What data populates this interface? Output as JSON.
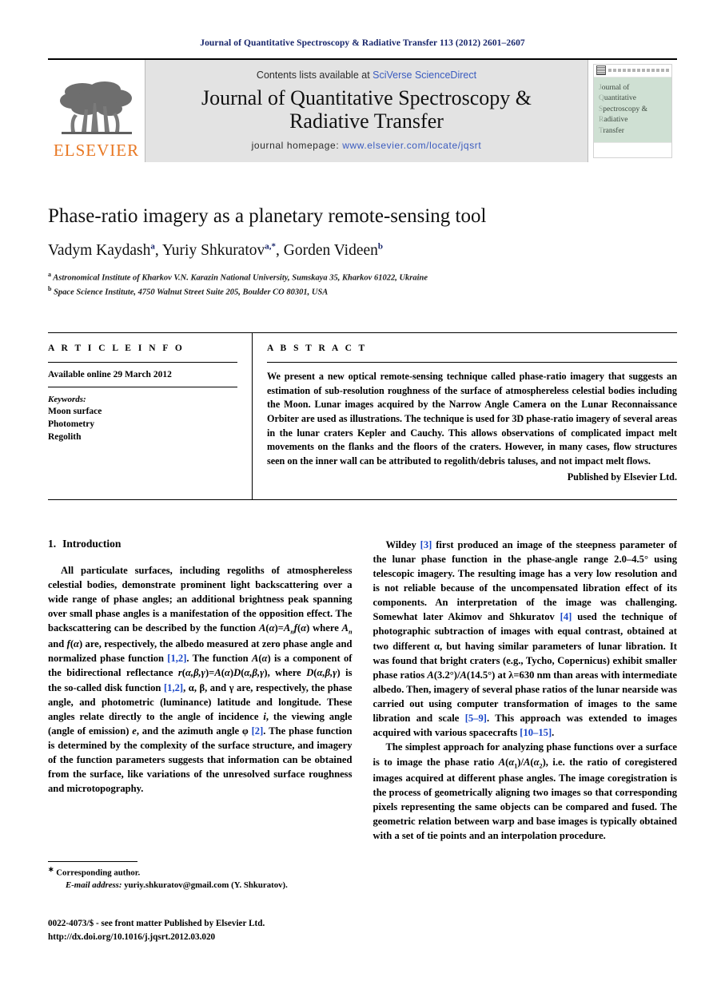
{
  "running_head": "Journal of Quantitative Spectroscopy & Radiative Transfer 113 (2012) 2601–2607",
  "masthead": {
    "publisher_name": "ELSEVIER",
    "contents_prefix": "Contents lists available at ",
    "contents_link": "SciVerse ScienceDirect",
    "journal_title_line1": "Journal of Quantitative Spectroscopy &",
    "journal_title_line2": "Radiative Transfer",
    "homepage_prefix": "journal homepage: ",
    "homepage_url": "www.elsevier.com/locate/jqsrt",
    "cover_lines": [
      "ournal of",
      "uantitative",
      "pectroscopy &",
      "adiative",
      "ransfer"
    ],
    "cover_caps": [
      "J",
      "Q",
      "S",
      "R",
      "T"
    ]
  },
  "article": {
    "title": "Phase-ratio imagery as a planetary remote-sensing tool",
    "authors": [
      {
        "name": "Vadym Kaydash",
        "marks": "a",
        "sep": ", "
      },
      {
        "name": "Yuriy Shkuratov",
        "marks": "a,*",
        "sep": ", "
      },
      {
        "name": "Gorden Videen",
        "marks": "b",
        "sep": ""
      }
    ],
    "affiliations": [
      {
        "mark": "a",
        "text": "Astronomical Institute of Kharkov V.N. Karazin National University, Sumskaya 35, Kharkov 61022, Ukraine"
      },
      {
        "mark": "b",
        "text": "Space Science Institute, 4750 Walnut Street Suite 205, Boulder CO 80301, USA"
      }
    ]
  },
  "info": {
    "heading": "A R T I C L E   I N F O",
    "history": "Available online 29 March 2012",
    "keywords_label": "Keywords:",
    "keywords": [
      "Moon surface",
      "Photometry",
      "Regolith"
    ]
  },
  "abstract": {
    "heading": "A B S T R A C T",
    "text": "We present a new optical remote-sensing technique called phase-ratio imagery that suggests an estimation of sub-resolution roughness of the surface of atmosphereless celestial bodies including the Moon. Lunar images acquired by the Narrow Angle Camera on the Lunar Reconnaissance Orbiter are used as illustrations. The technique is used for 3D phase-ratio imagery of several areas in the lunar craters Kepler and Cauchy. This allows observations of complicated impact melt movements on the flanks and the floors of the craters. However, in many cases, flow structures seen on the inner wall can be attributed to regolith/debris taluses, and not impact melt flows.",
    "publisher_note": "Published by Elsevier Ltd."
  },
  "body": {
    "section_number": "1.",
    "section_title": "Introduction",
    "left_paragraph_1_a": "All particulate surfaces, including regoliths of atmosphereless celestial bodies, demonstrate prominent light backscattering over a wide range of phase angles; an additional brightness peak spanning over small phase angles is a manifestation of the opposition effect. The backscattering can be described by the function ",
    "left_paragraph_1_b": " where ",
    "left_paragraph_1_c": " and ",
    "left_paragraph_1_d": " are, respectively, the albedo measured at zero phase angle and normalized phase function ",
    "ref_12": "[1,2]",
    "left_paragraph_1_e": ". The function ",
    "left_paragraph_1_f": " is a component of the bidirectional reflectance ",
    "left_paragraph_1_g": ", where ",
    "left_paragraph_1_h": " is the so-called disk function ",
    "left_paragraph_1_i": ", α, β, and γ are, respectively, the phase angle, and photometric (luminance) latitude and longitude. These angles relate directly to the angle of incidence ",
    "left_paragraph_1_j": ", the viewing angle (angle of emission) ",
    "left_paragraph_1_k": ", and the azimuth angle φ ",
    "ref_2": "[2]",
    "left_paragraph_1_l": ". The phase function is determined by the complexity of the surface structure, and imagery of the function parameters suggests that information can be obtained from the surface, like variations of the unresolved surface roughness and microtopography.",
    "right_paragraph_1_a": "Wildey ",
    "ref_3": "[3]",
    "right_paragraph_1_b": " first produced an image of the steepness parameter of the lunar phase function in the phase-angle range 2.0–4.5° using telescopic imagery. The resulting image has a very low resolution and is not reliable because of the uncompensated libration effect of its components. An interpretation of the image was challenging. Somewhat later Akimov and Shkuratov ",
    "ref_4": "[4]",
    "right_paragraph_1_c": " used the technique of photographic subtraction of images with equal contrast, obtained at two different α, but having similar parameters of lunar libration. It was found that bright craters (e.g., Tycho, Copernicus) exhibit smaller phase ratios ",
    "right_paragraph_1_d": " at λ=630 nm than areas with intermediate albedo. Then, imagery of several phase ratios of the lunar nearside was carried out using computer transformation of images to the same libration and scale ",
    "ref_59": "[5–9]",
    "right_paragraph_1_e": ". This approach was extended to images acquired with various spacecrafts ",
    "ref_1015": "[10–15]",
    "right_paragraph_1_f": ".",
    "right_paragraph_2_a": "The simplest approach for analyzing phase functions over a surface is to image the phase ratio ",
    "right_paragraph_2_b": ", i.e. the ratio of coregistered images acquired at different phase angles. The image coregistration is the process of geometrically aligning two images so that corresponding pixels representing the same objects can be compared and fused. The geometric relation between warp and base images is typically obtained with a set of tie points and an interpolation procedure."
  },
  "footnotes": {
    "corresponding": "Corresponding author.",
    "email_label": "E-mail address:",
    "email_value": "yuriy.shkuratov@gmail.com (Y. Shkuratov).",
    "issn_line": "0022-4073/$ - see front matter Published by Elsevier Ltd.",
    "doi_line": "http://dx.doi.org/10.1016/j.jqsrt.2012.03.020"
  },
  "colors": {
    "running_head": "#17256b",
    "link": "#3a5bbf",
    "reference": "#1a46c8",
    "elsevier_orange": "#E87722",
    "masthead_band": "#e3e3e3",
    "cover_band": "#cfe0d3"
  }
}
